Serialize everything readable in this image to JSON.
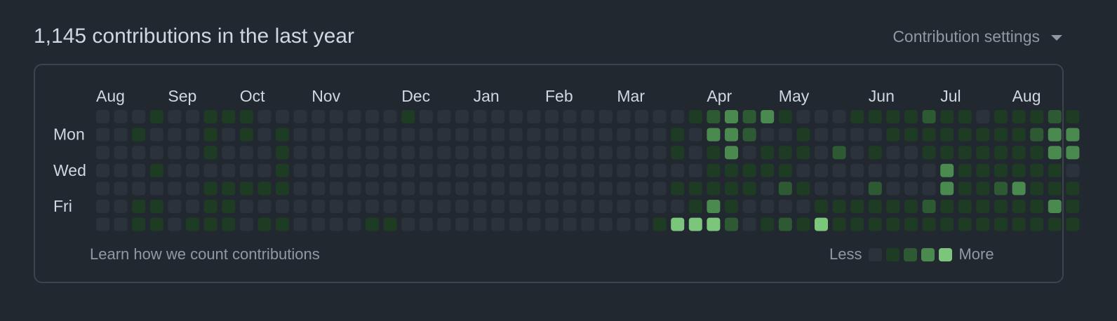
{
  "header": {
    "title": "1,145 contributions in the last year",
    "settings_label": "Contribution settings",
    "settings_icon": "triangle-down-icon"
  },
  "graph": {
    "months": [
      {
        "label": "Aug",
        "week": 0
      },
      {
        "label": "Sep",
        "week": 4
      },
      {
        "label": "Oct",
        "week": 8
      },
      {
        "label": "Nov",
        "week": 12
      },
      {
        "label": "Dec",
        "week": 17
      },
      {
        "label": "Jan",
        "week": 21
      },
      {
        "label": "Feb",
        "week": 25
      },
      {
        "label": "Mar",
        "week": 29
      },
      {
        "label": "Apr",
        "week": 34
      },
      {
        "label": "May",
        "week": 38
      },
      {
        "label": "Jun",
        "week": 43
      },
      {
        "label": "Jul",
        "week": 47
      },
      {
        "label": "Aug",
        "week": 51
      }
    ],
    "day_labels": [
      {
        "label": "Mon",
        "row": 1
      },
      {
        "label": "Wed",
        "row": 3
      },
      {
        "label": "Fri",
        "row": 5
      }
    ],
    "colors": [
      "#2b323b",
      "#1e3c23",
      "#2e5a33",
      "#4a8a4e",
      "#7cc67c"
    ],
    "levels": [
      "0001001110000000010000000000000001232310001111211011121",
      "0010001010100000000000000000000010332001000011111111233",
      "0000001000100000000000000000000010130111020100111111133",
      "0001000000100000000000000000000000111110000000031111110",
      "0000001111100000000000000000000011111021000200031123111",
      "0011001100000000000000000000000001310000111111211111131",
      "0011011101100001100000000000000144420121411111111111111"
    ]
  },
  "footer": {
    "learn_link": "Learn how we count contributions",
    "less_label": "Less",
    "more_label": "More"
  }
}
